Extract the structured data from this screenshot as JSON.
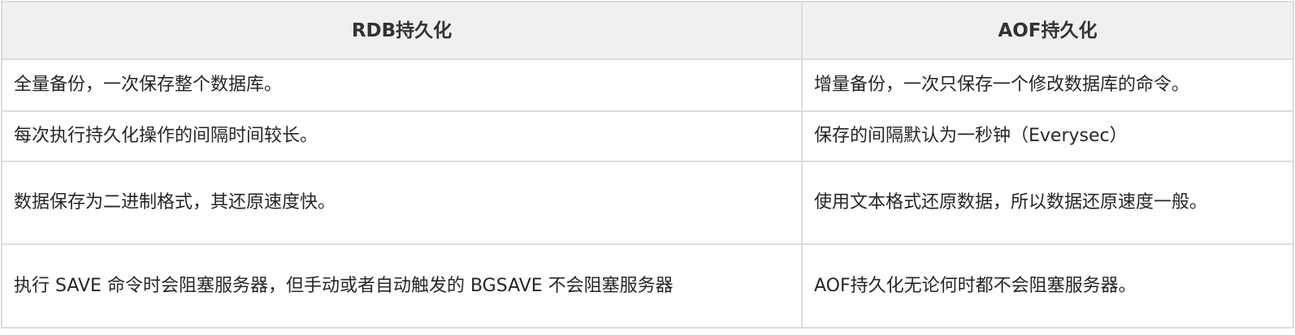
{
  "table": {
    "headers": [
      "RDB持久化",
      "AOF持久化"
    ],
    "rows": [
      [
        "全量备份，一次保存整个数据库。",
        "增量备份，一次只保存一个修改数据库的命令。"
      ],
      [
        "每次执行持久化操作的间隔时间较长。",
        "保存的间隔默认为一秒钟（Everysec）"
      ],
      [
        "数据保存为二进制格式，其还原速度快。",
        "使用文本格式还原数据，所以数据还原速度一般。"
      ],
      [
        "执行 SAVE 命令时会阻塞服务器，但手动或者自动触发的 BGSAVE 不会阻塞服务器",
        "AOF持久化无论何时都不会阻塞服务器。"
      ]
    ]
  }
}
